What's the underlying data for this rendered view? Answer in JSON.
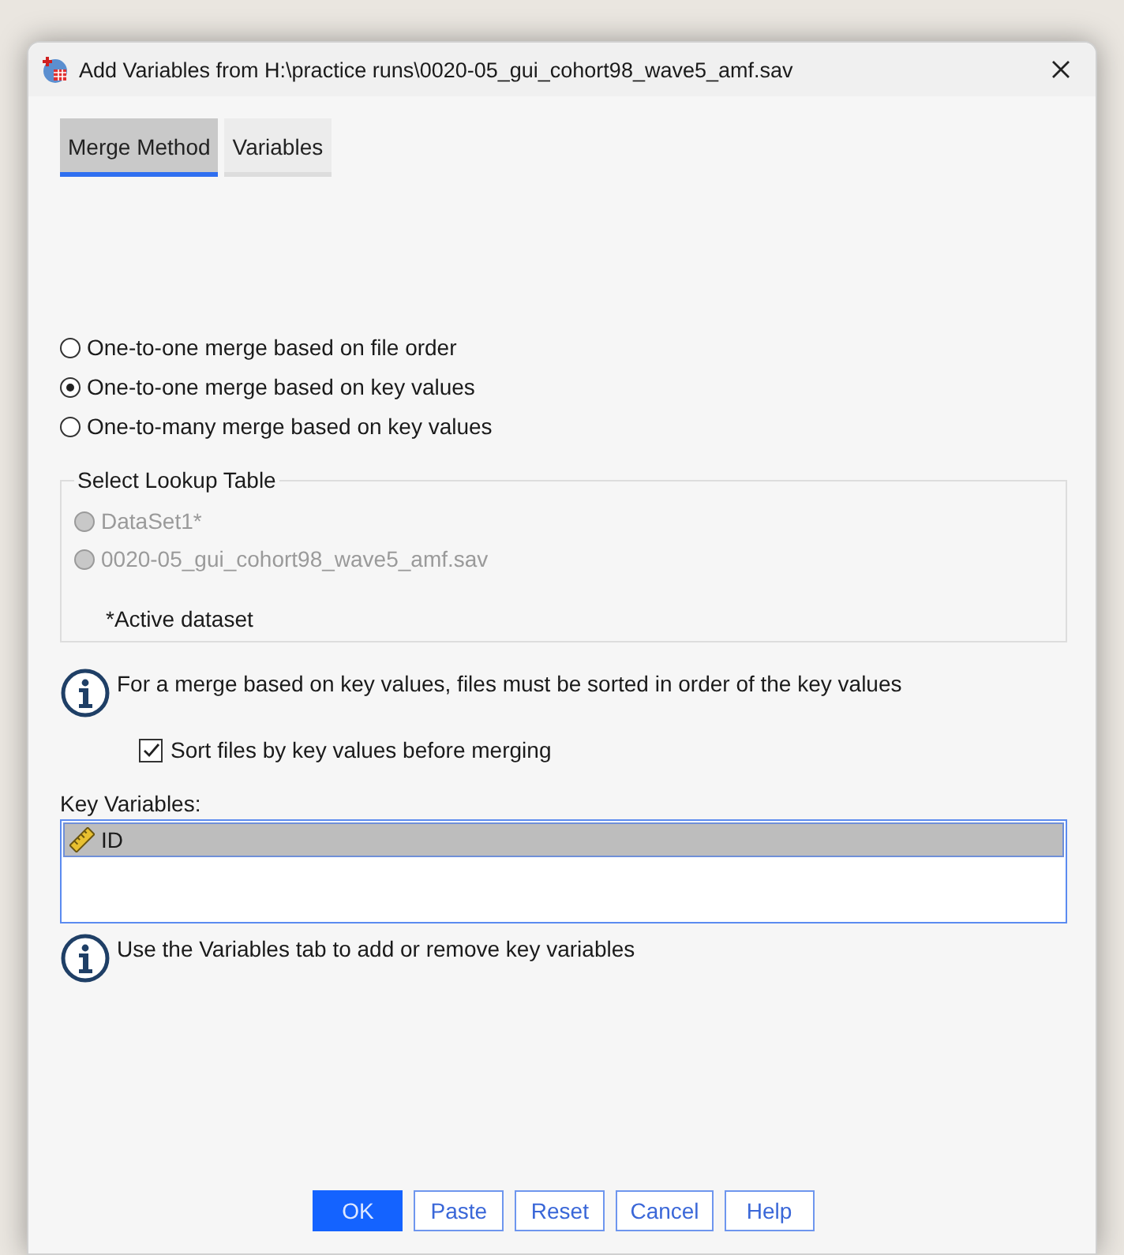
{
  "window": {
    "title": "Add Variables from H:\\practice runs\\0020-05_gui_cohort98_wave5_amf.sav"
  },
  "tabs": [
    {
      "label": "Merge Method",
      "selected": true
    },
    {
      "label": "Variables",
      "selected": false
    }
  ],
  "merge_options": [
    {
      "label": "One-to-one merge based on file order",
      "selected": false
    },
    {
      "label": "One-to-one merge based on key values",
      "selected": true
    },
    {
      "label": "One-to-many merge based on key values",
      "selected": false
    }
  ],
  "lookup_table": {
    "title": "Select Lookup Table",
    "options": [
      {
        "label": "DataSet1*",
        "selected": false,
        "disabled": true
      },
      {
        "label": "0020-05_gui_cohort98_wave5_amf.sav",
        "selected": false,
        "disabled": true
      }
    ],
    "note": "*Active dataset"
  },
  "sort_info": "For a merge based on key values, files must be sorted in order of the key values",
  "sort_checkbox": {
    "label": "Sort files by key values before merging",
    "checked": true
  },
  "key_variables": {
    "label": "Key Variables:",
    "items": [
      {
        "name": "ID",
        "selected": true
      }
    ]
  },
  "key_info": "Use the Variables tab to add or remove key variables",
  "buttons": [
    {
      "label": "OK",
      "kind": "primary"
    },
    {
      "label": "Paste",
      "kind": "normal"
    },
    {
      "label": "Reset",
      "kind": "normal"
    },
    {
      "label": "Cancel",
      "kind": "normal"
    },
    {
      "label": "Help",
      "kind": "normal"
    }
  ]
}
